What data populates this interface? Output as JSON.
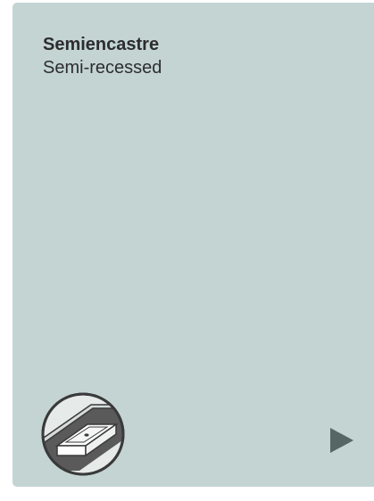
{
  "card": {
    "title": "Semiencastre",
    "subtitle": "Semi-recessed",
    "icon": "semi-recessed-basin-icon",
    "arrow_icon": "play-arrow-icon"
  },
  "colors": {
    "card_background": "#c3d4d3",
    "text": "#2d2d2d",
    "arrow": "#556664",
    "icon_stroke": "#3a3a3a",
    "icon_dark": "#5a5a5a"
  }
}
